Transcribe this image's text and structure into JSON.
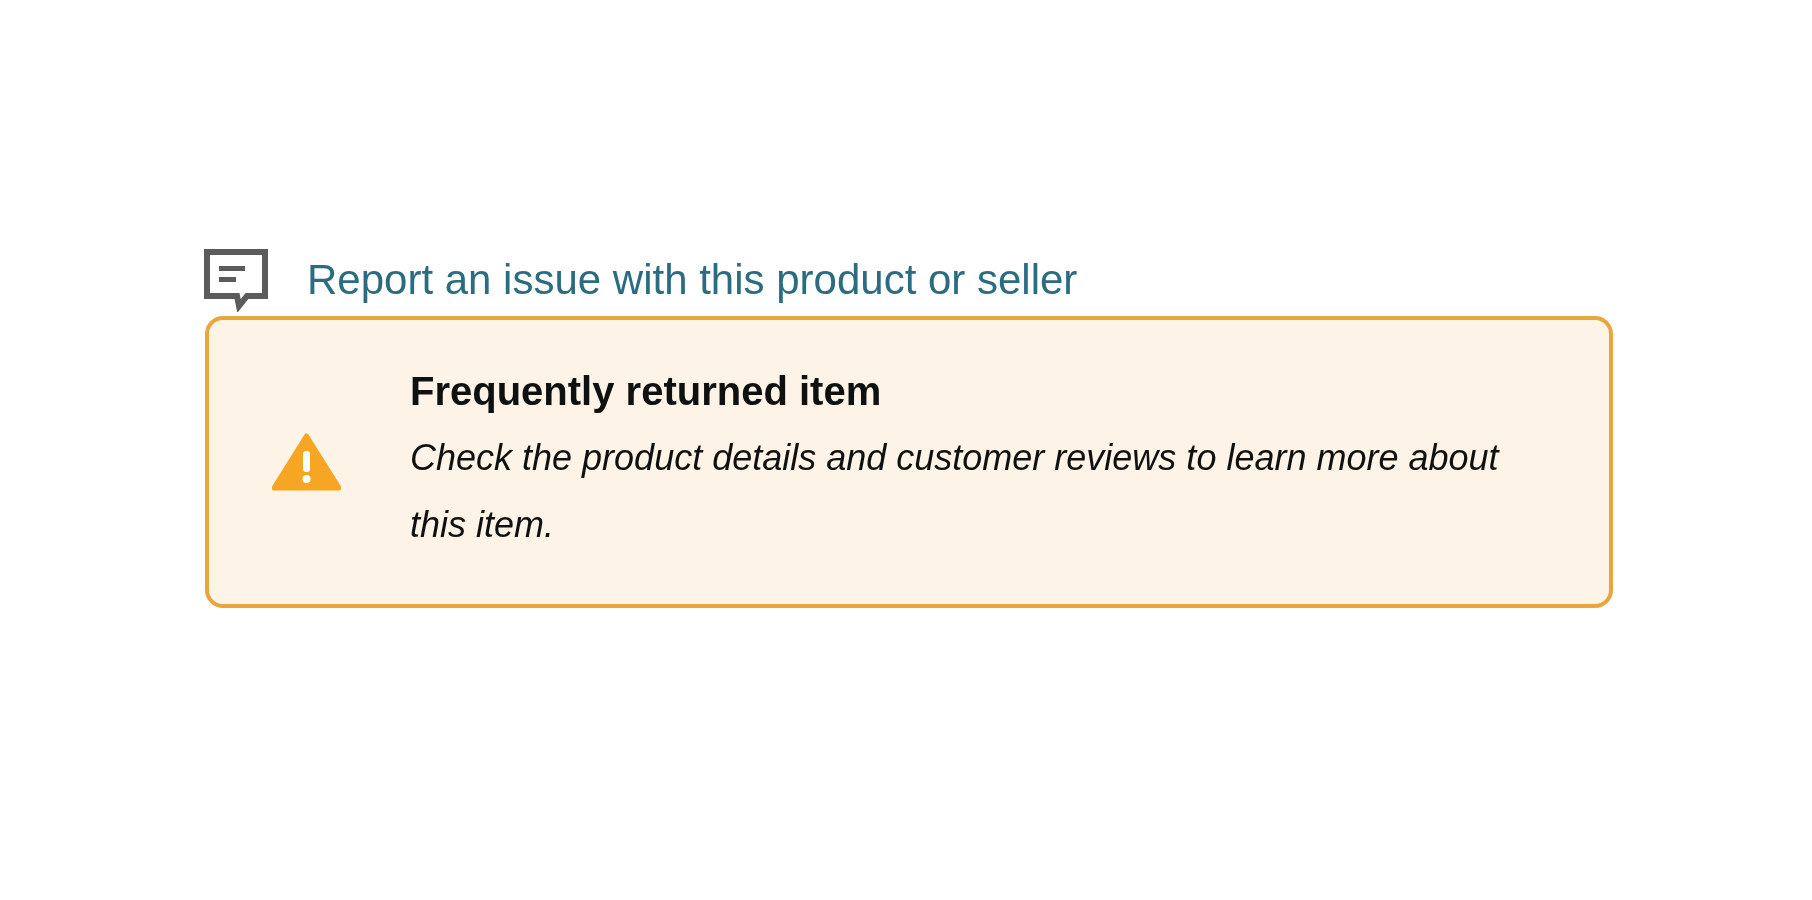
{
  "report_link": {
    "label": "Report an issue with this product or seller"
  },
  "alert": {
    "kind": "warning",
    "title": "Frequently returned item",
    "message": "Check the product details and customer reviews to learn more about this item."
  }
}
